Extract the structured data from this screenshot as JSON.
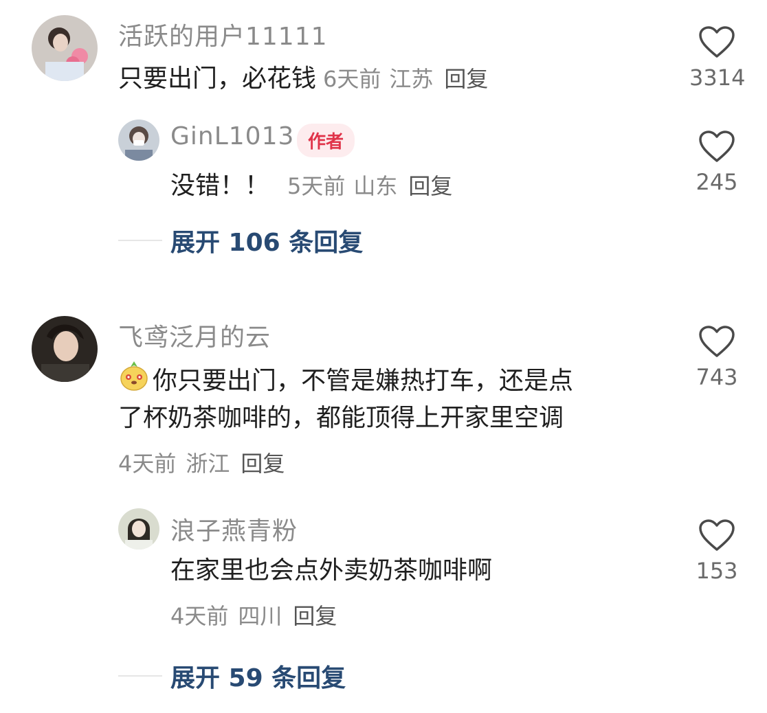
{
  "comments": [
    {
      "username": "活跃的用户11111",
      "text": "只要出门，必花钱",
      "time": "6天前",
      "location": "江苏",
      "reply_label": "回复",
      "likes": "3314",
      "replies": [
        {
          "username": "GinL1013",
          "badge": "作者",
          "text": "没错！！",
          "time": "5天前",
          "location": "山东",
          "reply_label": "回复",
          "likes": "245"
        }
      ],
      "expand_label": "展开 106 条回复"
    },
    {
      "username": "飞鸢泛月的云",
      "text_line1": "你只要出门，不管是嫌热打车，还是点",
      "text_line2": "了杯奶茶咖啡的，都能顶得上开家里空调",
      "emoji": "pineapple-face-emoji",
      "time": "4天前",
      "location": "浙江",
      "reply_label": "回复",
      "likes": "743",
      "replies": [
        {
          "username": "浪子燕青粉",
          "text": "在家里也会点外卖奶茶咖啡啊",
          "time": "4天前",
          "location": "四川",
          "reply_label": "回复",
          "likes": "153"
        }
      ],
      "expand_label": "展开 59 条回复"
    }
  ],
  "colors": {
    "accent_link": "#284a73",
    "author_badge_bg": "#fdecee",
    "author_badge_text": "#e0344a",
    "meta": "#8a8a8a"
  }
}
